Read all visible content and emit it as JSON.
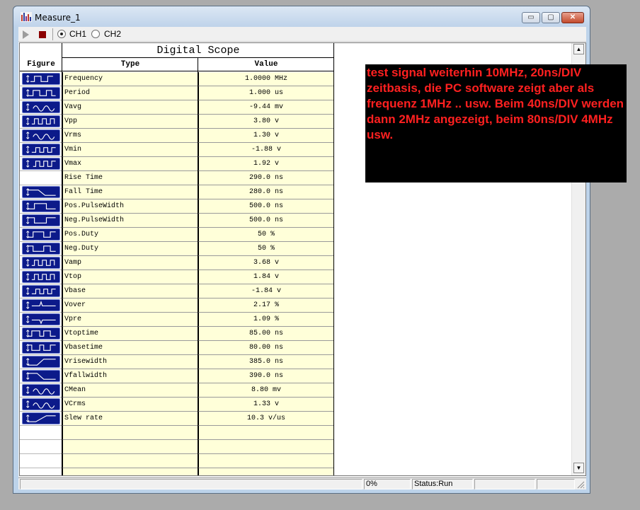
{
  "window": {
    "title": "Measure_1",
    "buttons": {
      "minimize": "▭",
      "maximize": "▢",
      "close": "✕"
    }
  },
  "toolbar": {
    "ch1_label": "CH1",
    "ch2_label": "CH2",
    "selected_channel": "CH1"
  },
  "table": {
    "title": "Digital Scope",
    "columns": {
      "figure": "Figure",
      "type": "Type",
      "value": "Value"
    },
    "rows": [
      {
        "type": "Frequency",
        "value": "1.0000 MHz",
        "icon": "frequency-icon"
      },
      {
        "type": "Period",
        "value": "1.000 us",
        "icon": "period-icon"
      },
      {
        "type": "Vavg",
        "value": "-9.44 mv",
        "icon": "vavg-icon"
      },
      {
        "type": "Vpp",
        "value": "3.80 v",
        "icon": "vpp-icon"
      },
      {
        "type": "Vrms",
        "value": "1.30 v",
        "icon": "vrms-icon"
      },
      {
        "type": "Vmin",
        "value": "-1.88 v",
        "icon": "vmin-icon"
      },
      {
        "type": "Vmax",
        "value": "1.92 v",
        "icon": "vmax-icon"
      },
      {
        "type": "Rise Time",
        "value": "290.0 ns",
        "icon": ""
      },
      {
        "type": "Fall Time",
        "value": "280.0 ns",
        "icon": "fall-time-icon"
      },
      {
        "type": "Pos.PulseWidth",
        "value": "500.0 ns",
        "icon": "pos-pulsewidth-icon"
      },
      {
        "type": "Neg.PulseWidth",
        "value": "500.0 ns",
        "icon": "neg-pulsewidth-icon"
      },
      {
        "type": "Pos.Duty",
        "value": "50 %",
        "icon": "pos-duty-icon"
      },
      {
        "type": "Neg.Duty",
        "value": "50 %",
        "icon": "neg-duty-icon"
      },
      {
        "type": "Vamp",
        "value": "3.68 v",
        "icon": "vamp-icon"
      },
      {
        "type": "Vtop",
        "value": "1.84 v",
        "icon": "vtop-icon"
      },
      {
        "type": "Vbase",
        "value": "-1.84 v",
        "icon": "vbase-icon"
      },
      {
        "type": "Vover",
        "value": "2.17 %",
        "icon": "vover-icon"
      },
      {
        "type": "Vpre",
        "value": "1.09 %",
        "icon": "vpre-icon"
      },
      {
        "type": "Vtoptime",
        "value": "85.00 ns",
        "icon": "vtoptime-icon"
      },
      {
        "type": "Vbasetime",
        "value": "80.00 ns",
        "icon": "vbasetime-icon"
      },
      {
        "type": "Vrisewidth",
        "value": "385.0 ns",
        "icon": "vrisewidth-icon"
      },
      {
        "type": "Vfallwidth",
        "value": "390.0 ns",
        "icon": "vfallwidth-icon"
      },
      {
        "type": "CMean",
        "value": "8.80 mv",
        "icon": "cmean-icon"
      },
      {
        "type": "VCrms",
        "value": "1.33 v",
        "icon": "vcrms-icon"
      },
      {
        "type": "Slew rate",
        "value": "10.3 v/us",
        "icon": "slew-rate-icon"
      },
      {
        "type": "",
        "value": "",
        "icon": ""
      },
      {
        "type": "",
        "value": "",
        "icon": ""
      },
      {
        "type": "",
        "value": "",
        "icon": ""
      },
      {
        "type": "",
        "value": "",
        "icon": ""
      }
    ]
  },
  "note": {
    "text": "test signal weiterhin 10MHz, 20ns/DIV zeitbasis, die PC software zeigt aber als frequenz 1MHz .. usw. Beim 40ns/DIV werden dann 2MHz angezeigt, beim 80ns/DIV 4MHz usw."
  },
  "scrollbar": {
    "up": "▲",
    "down": "▼"
  },
  "statusbar": {
    "progress": "0%",
    "status": "Status:Run"
  }
}
